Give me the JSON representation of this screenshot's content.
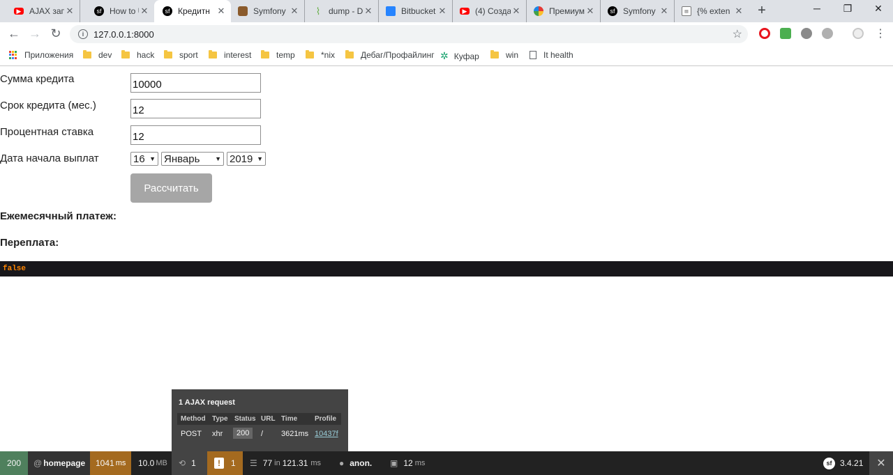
{
  "tabs": [
    {
      "title": "AJAX зап",
      "icon": "youtube-icon",
      "color": "#ff0000"
    },
    {
      "title": "How to U",
      "icon": "symfony-icon",
      "color": "#000000"
    },
    {
      "title": "Кредитн",
      "icon": "symfony-icon",
      "color": "#000000"
    },
    {
      "title": "Symfony",
      "icon": "symfonycasts-icon",
      "color": "#8a5a2b"
    },
    {
      "title": "dump - D",
      "icon": "laravel-icon",
      "color": "#6ab04c"
    },
    {
      "title": "Bitbucket",
      "icon": "bitbucket-icon",
      "color": "#2684ff"
    },
    {
      "title": "(4) Созда",
      "icon": "youtube-icon",
      "color": "#ff0000"
    },
    {
      "title": "Премиум",
      "icon": "pinwheel-icon",
      "color": "#e53935"
    },
    {
      "title": "Symfony",
      "icon": "symfony-icon",
      "color": "#000000"
    },
    {
      "title": "{% exten",
      "icon": "postman-icon",
      "color": "#777777"
    }
  ],
  "address": {
    "url": "127.0.0.1:8000"
  },
  "bookmarks": [
    {
      "label": "Приложения",
      "icon": "apps-grid-icon"
    },
    {
      "label": "dev",
      "icon": "folder-icon"
    },
    {
      "label": "hack",
      "icon": "folder-icon"
    },
    {
      "label": "sport",
      "icon": "folder-icon"
    },
    {
      "label": "interest",
      "icon": "folder-icon"
    },
    {
      "label": "temp",
      "icon": "folder-icon"
    },
    {
      "label": "*nix",
      "icon": "folder-icon"
    },
    {
      "label": "Дебаг/Профайлинг",
      "icon": "folder-icon"
    },
    {
      "label": "Куфар",
      "icon": "kufar-icon"
    },
    {
      "label": "win",
      "icon": "folder-icon"
    },
    {
      "label": "It health",
      "icon": "page-icon"
    }
  ],
  "form": {
    "amount": {
      "label": "Сумма кредита",
      "value": "10000"
    },
    "term": {
      "label": "Срок кредита (мес.)",
      "value": "12"
    },
    "rate": {
      "label": "Процентная ставка",
      "value": "12"
    },
    "start_date": {
      "label": "Дата начала выплат",
      "day": "16",
      "month": "Январь",
      "year": "2019"
    },
    "submit": "Рассчитать"
  },
  "results": {
    "monthly": "Ежемесячный платеж:",
    "overpay": "Переплата:"
  },
  "dump": "false",
  "ajax": {
    "heading": "1 AJAX request",
    "columns": [
      "Method",
      "Type",
      "Status",
      "URL",
      "Time",
      "Profile"
    ],
    "row": {
      "method": "POST",
      "type": "xhr",
      "status": "200",
      "url": "/",
      "time": "3621ms",
      "profile": "10437f"
    }
  },
  "toolbar": {
    "status": "200",
    "route": "homepage",
    "time": "1041",
    "time_unit": "ms",
    "memory": "10.0",
    "memory_unit": "MB",
    "ajax_count": "1",
    "logs_count": "1",
    "cache_count": "77",
    "cache_in": "in",
    "cache_time": "121.31",
    "cache_unit": "ms",
    "user": "anon.",
    "twig_time": "12",
    "twig_unit": "ms",
    "version": "3.4.21",
    "colors": {
      "status": "#4f805d",
      "time": "#a46a1f",
      "logs": "#a46a1f"
    }
  }
}
